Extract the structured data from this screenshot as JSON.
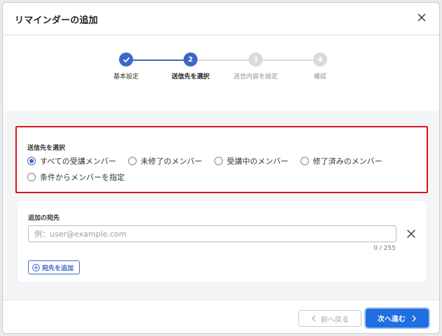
{
  "dialog": {
    "title": "リマインダーの追加"
  },
  "stepper": {
    "steps": [
      {
        "number": "1",
        "label": "基本設定",
        "state": "done"
      },
      {
        "number": "2",
        "label": "送信先を選択",
        "state": "active"
      },
      {
        "number": "3",
        "label": "送信内容を設定",
        "state": "pending"
      },
      {
        "number": "4",
        "label": "確認",
        "state": "pending"
      }
    ]
  },
  "recipient_section": {
    "title": "送信先を選択",
    "options": [
      {
        "label": "すべての受講メンバー",
        "checked": true
      },
      {
        "label": "未修了のメンバー",
        "checked": false
      },
      {
        "label": "受講中のメンバー",
        "checked": false
      },
      {
        "label": "修了済みのメンバー",
        "checked": false
      },
      {
        "label": "条件からメンバーを指定",
        "checked": false
      }
    ]
  },
  "extra_section": {
    "title": "追加の宛先",
    "email_placeholder": "例：user@example.com",
    "counter": "0 / 255",
    "add_button_label": "宛先を追加"
  },
  "footer": {
    "back_label": "前へ戻る",
    "next_label": "次へ進む"
  },
  "colors": {
    "primary": "#3c67c7",
    "next_button": "#1f6fe0",
    "highlight_border": "#d9141a"
  }
}
